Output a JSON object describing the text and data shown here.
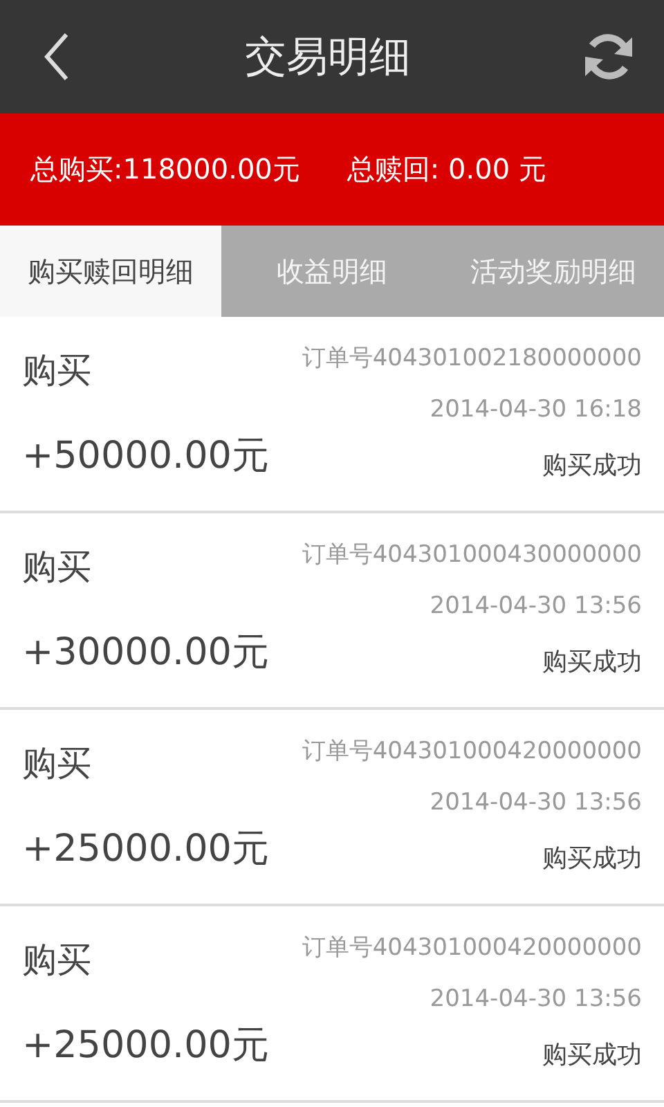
{
  "header": {
    "title": "交易明细"
  },
  "summary": {
    "purchase_label": "总购买:",
    "purchase_value": "118000.00元",
    "redeem_label": "总赎回:",
    "redeem_value": "0.00 元"
  },
  "tabs": [
    {
      "label": "购买赎回明细",
      "selected": true
    },
    {
      "label": "收益明细",
      "selected": false
    },
    {
      "label": "活动奖励明细",
      "selected": false
    }
  ],
  "records": [
    {
      "type": "购买",
      "order": "订单号404301002180000000",
      "time": "2014-04-30 16:18",
      "amount": "+50000.00元",
      "status": "购买成功"
    },
    {
      "type": "购买",
      "order": "订单号404301000430000000",
      "time": "2014-04-30 13:56",
      "amount": "+30000.00元",
      "status": "购买成功"
    },
    {
      "type": "购买",
      "order": "订单号404301000420000000",
      "time": "2014-04-30 13:56",
      "amount": "+25000.00元",
      "status": "购买成功"
    },
    {
      "type": "购买",
      "order": "订单号404301000420000000",
      "time": "2014-04-30 13:56",
      "amount": "+25000.00元",
      "status": "购买成功"
    }
  ]
}
